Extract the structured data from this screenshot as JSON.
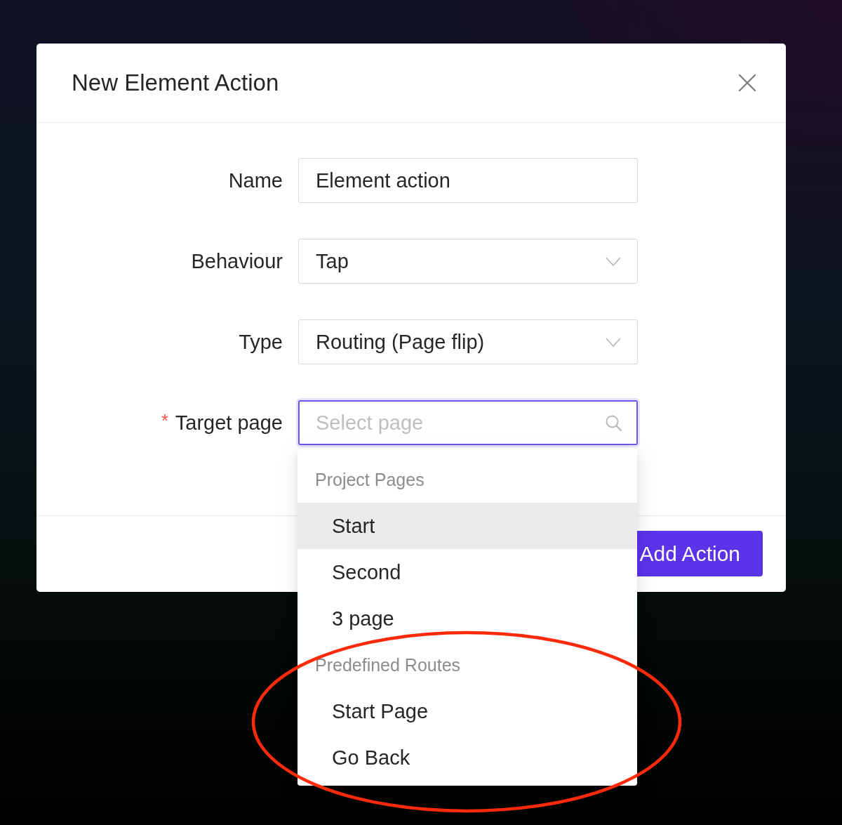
{
  "dialog": {
    "title": "New Element Action"
  },
  "form": {
    "fields": [
      {
        "kind": "text",
        "label": "Name",
        "value": "Element action",
        "focused": false
      },
      {
        "kind": "select",
        "label": "Behaviour",
        "value": "Tap",
        "focused": false
      },
      {
        "kind": "select",
        "label": "Type",
        "value": "Routing (Page flip)",
        "focused": false
      },
      {
        "kind": "search",
        "label": "Target page",
        "required_mark": "*",
        "placeholder": "Select page",
        "focused": true,
        "dropdown": {
          "groups": [
            {
              "title": "Project Pages",
              "options": [
                {
                  "label": "Start",
                  "selected": true
                },
                {
                  "label": "Second",
                  "selected": false
                },
                {
                  "label": "3 page",
                  "selected": false
                }
              ]
            },
            {
              "title": "Predefined Routes",
              "options": [
                {
                  "label": "Start Page",
                  "selected": false
                },
                {
                  "label": "Go Back",
                  "selected": false
                }
              ]
            }
          ]
        }
      }
    ]
  },
  "footer": {
    "buttons": [
      {
        "label": "Add Action",
        "kind": "primary"
      }
    ]
  }
}
